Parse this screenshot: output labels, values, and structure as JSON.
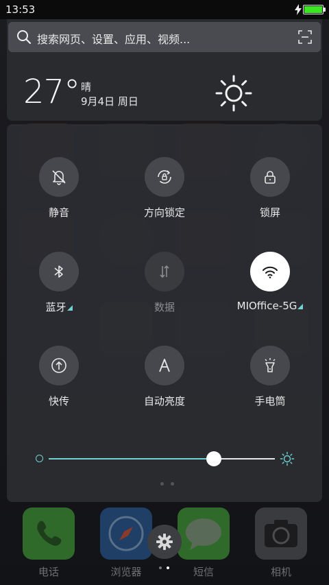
{
  "status_bar": {
    "time": "13:53",
    "battery_level": 1.0,
    "charging": true
  },
  "search": {
    "placeholder": "搜索网页、设置、应用、视频..."
  },
  "weather": {
    "temperature": "27°",
    "condition": "晴",
    "date": "9月4日 周日"
  },
  "quick_settings": {
    "toggles": [
      {
        "label": "静音",
        "icon": "bell-off-icon",
        "state": "off"
      },
      {
        "label": "方向锁定",
        "icon": "rotation-lock-icon",
        "state": "off"
      },
      {
        "label": "锁屏",
        "icon": "lock-icon",
        "state": "off"
      },
      {
        "label": "蓝牙",
        "icon": "bluetooth-icon",
        "state": "off"
      },
      {
        "label": "数据",
        "icon": "mobile-data-icon",
        "state": "disabled"
      },
      {
        "label": "MIOffice-5G",
        "icon": "wifi-icon",
        "state": "on"
      },
      {
        "label": "快传",
        "icon": "quick-transfer-icon",
        "state": "off"
      },
      {
        "label": "自动亮度",
        "icon": "auto-brightness-icon",
        "state": "off"
      },
      {
        "label": "手电筒",
        "icon": "flashlight-icon",
        "state": "off"
      }
    ],
    "brightness_level": 0.73
  },
  "dock": {
    "apps": [
      {
        "label": "电话",
        "icon": "phone-icon"
      },
      {
        "label": "浏览器",
        "icon": "browser-icon"
      },
      {
        "label": "短信",
        "icon": "messages-icon"
      },
      {
        "label": "相机",
        "icon": "camera-icon"
      }
    ]
  },
  "colors": {
    "accent": "#6fd3d6",
    "panel": "#2c2d31",
    "toggle_off": "#47484d",
    "toggle_on": "#ffffff",
    "battery": "#39e61f"
  }
}
